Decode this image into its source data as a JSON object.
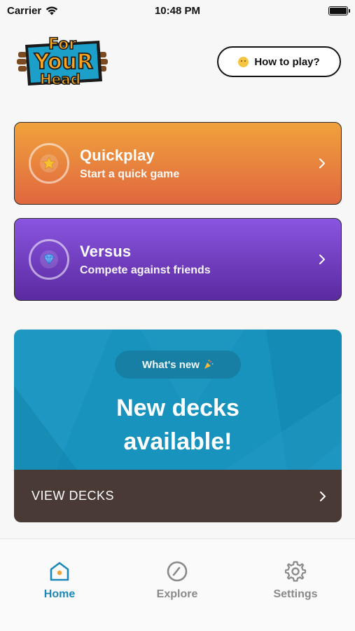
{
  "status_bar": {
    "carrier": "Carrier",
    "time": "10:48 PM"
  },
  "logo": {
    "line1": "For",
    "line2": "YouR",
    "line3": "Head"
  },
  "header": {
    "help_button_label": "How to play?",
    "help_emoji": "thinking-face-emoji"
  },
  "modes": [
    {
      "title": "Quickplay",
      "subtitle": "Start a quick game",
      "icon": "star-icon",
      "colors": [
        "#f0a23c",
        "#e0673f"
      ]
    },
    {
      "title": "Versus",
      "subtitle": "Compete against friends",
      "icon": "diamond-icon",
      "colors": [
        "#8a55e0",
        "#5a2aa0"
      ]
    }
  ],
  "promo": {
    "badge": "What's new",
    "badge_icon": "party-popper-icon",
    "headline_line1": "New decks",
    "headline_line2": "available!",
    "cta": "VIEW DECKS",
    "bg_color": "#1893bd",
    "cta_bg_color": "#4a3a36"
  },
  "tabs": [
    {
      "label": "Home",
      "icon": "home-icon",
      "active": true
    },
    {
      "label": "Explore",
      "icon": "compass-icon",
      "active": false
    },
    {
      "label": "Settings",
      "icon": "gear-icon",
      "active": false
    }
  ],
  "colors": {
    "accent": "#1a88b8",
    "inactive": "#8a8a8a"
  }
}
